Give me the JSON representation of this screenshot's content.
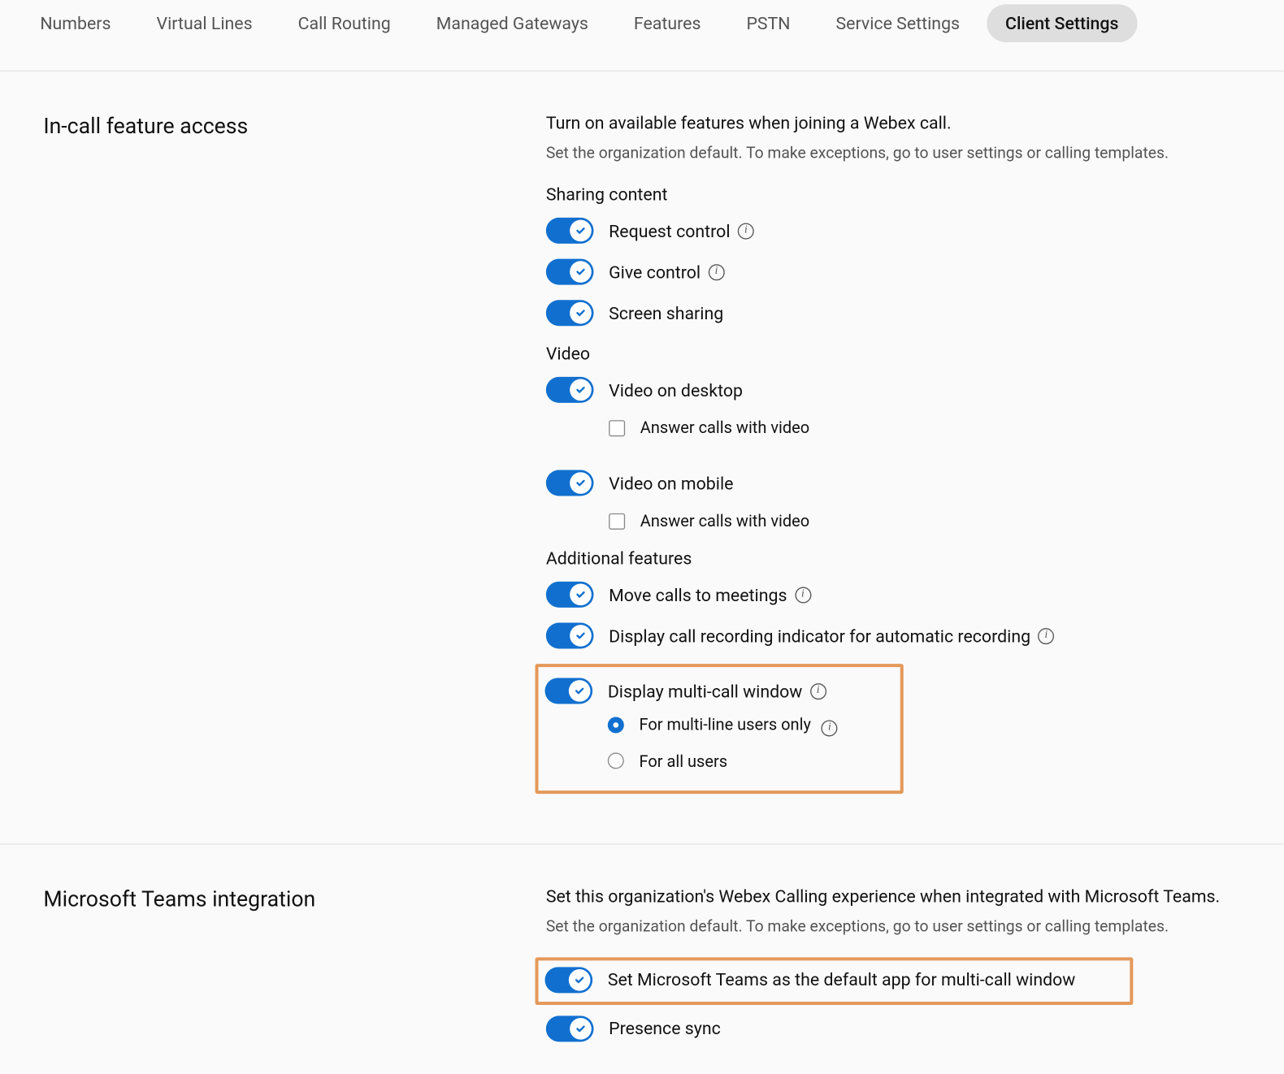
{
  "tabs": {
    "items": [
      "Numbers",
      "Virtual Lines",
      "Call Routing",
      "Managed Gateways",
      "Features",
      "PSTN",
      "Service Settings",
      "Client Settings"
    ]
  },
  "section1": {
    "title": "In-call feature access",
    "lead": "Turn on available features when joining a Webex call.",
    "sub": "Set the organization default. To make exceptions, go to user settings or calling templates.",
    "sharing_label": "Sharing content",
    "request_control": "Request control",
    "give_control": "Give control",
    "screen_sharing": "Screen sharing",
    "video_label": "Video",
    "video_desktop": "Video on desktop",
    "video_mobile": "Video on mobile",
    "answer_with_video": "Answer calls with video",
    "additional_label": "Additional features",
    "move_calls": "Move calls to meetings",
    "recording_indicator": "Display call recording indicator for automatic recording",
    "multicall": "Display multi-call window",
    "radio_multiline": "For multi-line users only",
    "radio_all": "For all users"
  },
  "section2": {
    "title": "Microsoft Teams integration",
    "lead": "Set this organization's Webex Calling experience when integrated with Microsoft Teams.",
    "sub": "Set the organization default. To make exceptions, go to user settings or calling templates.",
    "teams_default": "Set Microsoft Teams as the default app for multi-call window",
    "presence_sync": "Presence sync"
  }
}
